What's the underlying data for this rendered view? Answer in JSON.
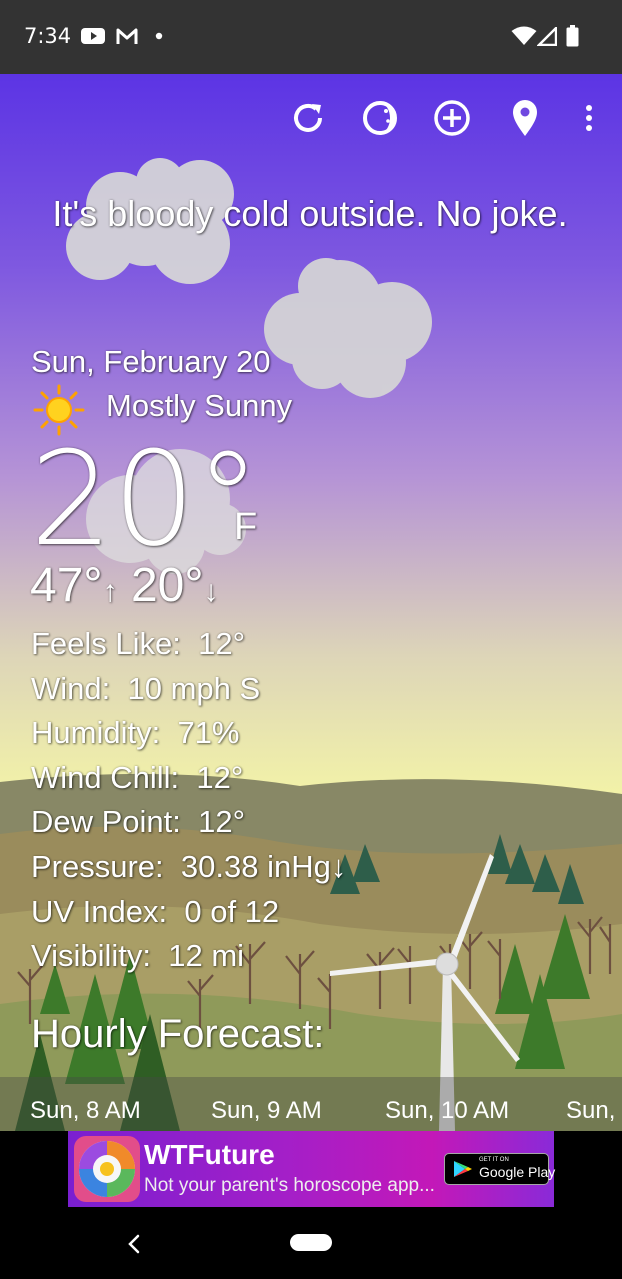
{
  "status_bar": {
    "time": "7:34"
  },
  "toolbar": {
    "icons": [
      "refresh-icon",
      "theme-icon",
      "add-location-icon",
      "location-pin-icon",
      "overflow-menu-icon"
    ]
  },
  "headline": "It's bloody cold outside. No joke.",
  "date": "Sun, February 20",
  "condition": {
    "icon": "sun-icon",
    "text": "Mostly Sunny"
  },
  "temperature": {
    "current": "20°",
    "unit": "F",
    "high": "47°",
    "high_arrow": "↑",
    "low": "20°",
    "low_arrow": "↓"
  },
  "details": [
    {
      "label": "Feels Like:",
      "value": "12°"
    },
    {
      "label": "Wind:",
      "value": "10 mph S"
    },
    {
      "label": "Humidity:",
      "value": "71%"
    },
    {
      "label": "Wind Chill:",
      "value": "12°"
    },
    {
      "label": "Dew Point:",
      "value": "12°"
    },
    {
      "label": "Pressure:",
      "value": "30.38 inHg↓"
    },
    {
      "label": "UV Index:",
      "value": "0 of 12"
    },
    {
      "label": "Visibility:",
      "value": "12 mi"
    }
  ],
  "hourly": {
    "title": "Hourly Forecast:",
    "hours": [
      "Sun, 8 AM",
      "Sun, 9 AM",
      "Sun, 10 AM",
      "Sun,"
    ]
  },
  "ad": {
    "title": "WTFuture",
    "subtitle": "Not your parent's horoscope app...",
    "badge_small": "GET IT ON",
    "badge_big": "Google Play"
  }
}
